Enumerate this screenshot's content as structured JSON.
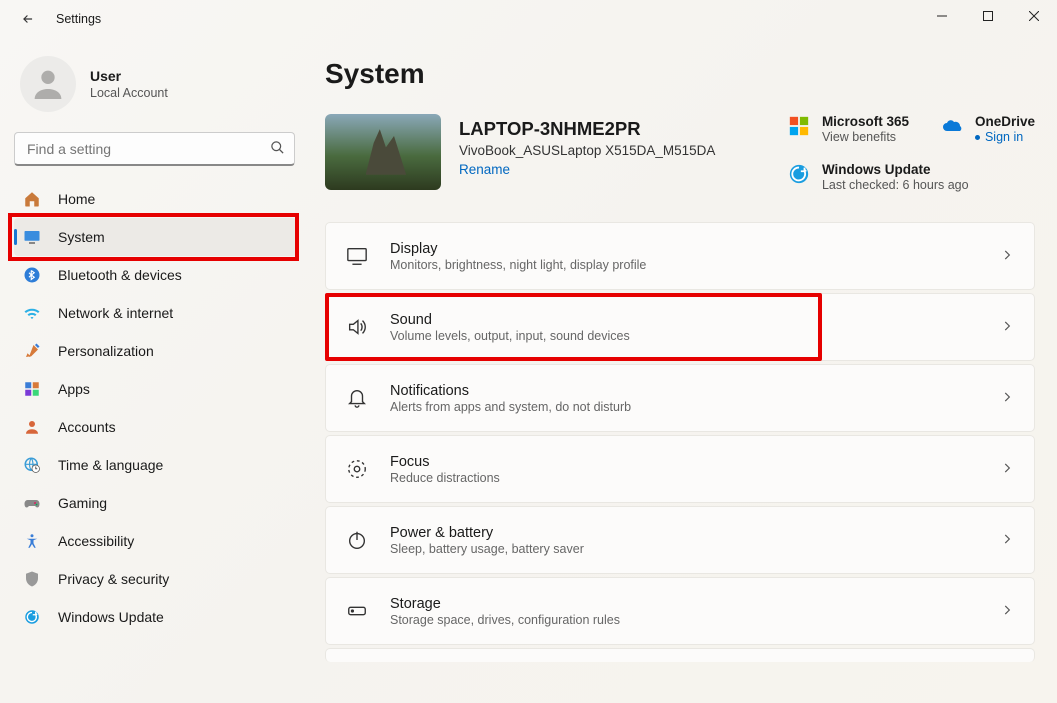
{
  "titlebar": {
    "title": "Settings"
  },
  "user": {
    "name": "User",
    "account_type": "Local Account"
  },
  "search": {
    "placeholder": "Find a setting"
  },
  "nav": [
    {
      "id": "home",
      "label": "Home"
    },
    {
      "id": "system",
      "label": "System"
    },
    {
      "id": "bluetooth",
      "label": "Bluetooth & devices"
    },
    {
      "id": "network",
      "label": "Network & internet"
    },
    {
      "id": "personalization",
      "label": "Personalization"
    },
    {
      "id": "apps",
      "label": "Apps"
    },
    {
      "id": "accounts",
      "label": "Accounts"
    },
    {
      "id": "time",
      "label": "Time & language"
    },
    {
      "id": "gaming",
      "label": "Gaming"
    },
    {
      "id": "accessibility",
      "label": "Accessibility"
    },
    {
      "id": "privacy",
      "label": "Privacy & security"
    },
    {
      "id": "update",
      "label": "Windows Update"
    }
  ],
  "page": {
    "title": "System"
  },
  "device": {
    "name": "LAPTOP-3NHME2PR",
    "model": "VivoBook_ASUSLaptop X515DA_M515DA",
    "rename": "Rename"
  },
  "status": {
    "ms365": {
      "title": "Microsoft 365",
      "sub": "View benefits"
    },
    "onedrive": {
      "title": "OneDrive",
      "sub": "Sign in"
    },
    "update": {
      "title": "Windows Update",
      "sub": "Last checked: 6 hours ago"
    }
  },
  "cards": [
    {
      "id": "display",
      "title": "Display",
      "sub": "Monitors, brightness, night light, display profile"
    },
    {
      "id": "sound",
      "title": "Sound",
      "sub": "Volume levels, output, input, sound devices"
    },
    {
      "id": "notifications",
      "title": "Notifications",
      "sub": "Alerts from apps and system, do not disturb"
    },
    {
      "id": "focus",
      "title": "Focus",
      "sub": "Reduce distractions"
    },
    {
      "id": "power",
      "title": "Power & battery",
      "sub": "Sleep, battery usage, battery saver"
    },
    {
      "id": "storage",
      "title": "Storage",
      "sub": "Storage space, drives, configuration rules"
    }
  ]
}
